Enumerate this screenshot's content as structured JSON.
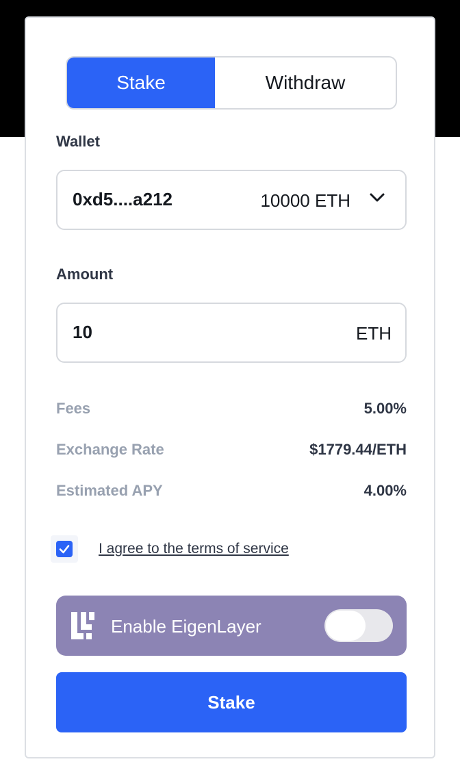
{
  "tabs": {
    "stake_label": "Stake",
    "withdraw_label": "Withdraw",
    "active": "Stake"
  },
  "wallet": {
    "label": "Wallet",
    "address": "0xd5....a212",
    "balance": "10000 ETH",
    "dropdown_icon": "chevron-down-icon"
  },
  "amount": {
    "label": "Amount",
    "value": "10",
    "unit": "ETH"
  },
  "info": [
    {
      "label": "Fees",
      "value": "5.00%"
    },
    {
      "label": "Exchange Rate",
      "value": "$1779.44/ETH"
    },
    {
      "label": "Estimated APY",
      "value": "4.00%"
    }
  ],
  "terms": {
    "checked": true,
    "text": "I agree to the terms of service"
  },
  "eigenlayer": {
    "label": "Enable EigenLayer",
    "icon": "eigenlayer-logo-icon",
    "enabled": false
  },
  "stake_button": {
    "label": "Stake"
  },
  "colors": {
    "accent": "#2b63f6",
    "eigen_bg": "#8c84b4",
    "muted_text": "#98a1b0",
    "header_band": "#000000"
  }
}
